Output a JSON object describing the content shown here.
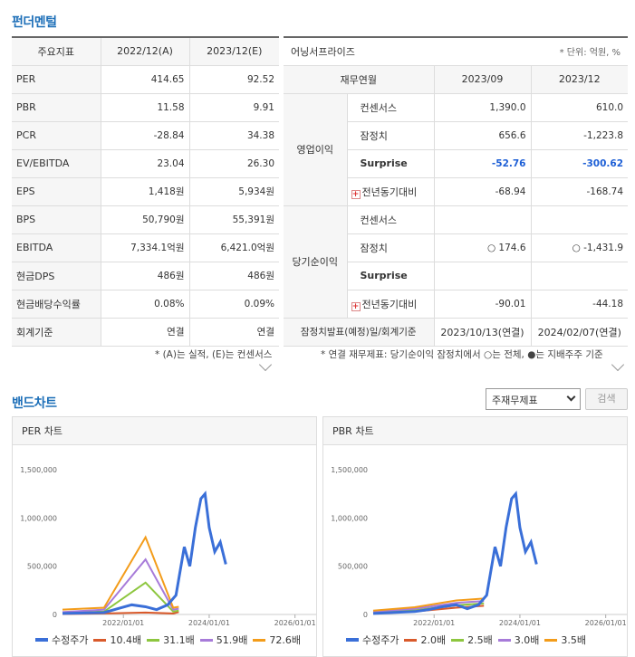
{
  "fundamentals": {
    "title": "펀더멘털",
    "table": {
      "headers": [
        "주요지표",
        "2022/12(A)",
        "2023/12(E)"
      ],
      "rows": [
        {
          "label": "PER",
          "a": "414.65",
          "e": "92.52"
        },
        {
          "label": "PBR",
          "a": "11.58",
          "e": "9.91"
        },
        {
          "label": "PCR",
          "a": "-28.84",
          "e": "34.38"
        },
        {
          "label": "EV/EBITDA",
          "a": "23.04",
          "e": "26.30"
        },
        {
          "label": "EPS",
          "a": "1,418원",
          "e": "5,934원"
        },
        {
          "label": "BPS",
          "a": "50,790원",
          "e": "55,391원"
        },
        {
          "label": "EBITDA",
          "a": "7,334.1억원",
          "e": "6,421.0억원"
        },
        {
          "label": "현금DPS",
          "a": "486원",
          "e": "486원"
        },
        {
          "label": "현금배당수익률",
          "a": "0.08%",
          "e": "0.09%"
        },
        {
          "label": "회계기준",
          "a": "연결",
          "e": "연결"
        }
      ],
      "note": "* (A)는 실적, (E)는 컨센서스"
    },
    "earnings": {
      "title": "어닝서프라이즈",
      "unit": "* 단위: 억원, %",
      "headers": [
        "재무연월",
        "2023/09",
        "2023/12"
      ],
      "op_group": "영업이익",
      "net_group": "당기순이익",
      "op_rows": [
        {
          "label": "컨센서스",
          "a": "1,390.0",
          "b": "610.0"
        },
        {
          "label": "잠정치",
          "a": "656.6",
          "b": "-1,223.8"
        },
        {
          "label": "Surprise",
          "a": "-52.76",
          "b": "-300.62"
        },
        {
          "label": "전년동기대비",
          "a": "-68.94",
          "b": "-168.74"
        }
      ],
      "net_rows": [
        {
          "label": "컨센서스",
          "a": "",
          "b": ""
        },
        {
          "label": "잠정치",
          "a": "○ 174.6",
          "b": "○ -1,431.9"
        },
        {
          "label": "Surprise",
          "a": "",
          "b": ""
        },
        {
          "label": "전년동기대비",
          "a": "-90.01",
          "b": "-44.18"
        }
      ],
      "footer": {
        "label": "잠정치발표(예정)일/회계기준",
        "a": "2023/10/13(연결)",
        "b": "2024/02/07(연결)"
      },
      "note": "* 연결 재무제표: 당기순이익 잠정치에서 ○는 전체, ●는 지배주주 기준"
    }
  },
  "band": {
    "title": "밴드차트",
    "select_value": "주재무제표",
    "search_label": "검색",
    "per_panel_title": "PER 차트",
    "pbr_panel_title": "PBR 차트"
  },
  "chart_data": [
    {
      "type": "line",
      "title": "PER 차트",
      "x_ticks": [
        "2022/01/01",
        "2024/01/01",
        "2026/01/01"
      ],
      "y_ticks": [
        "1,500,000",
        "1,000,000",
        "500,000",
        "0"
      ],
      "ylim": [
        0,
        1500000
      ],
      "series": [
        {
          "name": "수정주가",
          "color": "#3a6fd8",
          "points": [
            [
              0,
              10000
            ],
            [
              1.5,
              20000
            ],
            [
              2,
              60000
            ],
            [
              2.5,
              100000
            ],
            [
              3,
              80000
            ],
            [
              3.4,
              50000
            ],
            [
              3.8,
              100000
            ],
            [
              4.1,
              200000
            ],
            [
              4.4,
              700000
            ],
            [
              4.6,
              500000
            ],
            [
              4.8,
              900000
            ],
            [
              5.0,
              1200000
            ],
            [
              5.15,
              1250000
            ],
            [
              5.3,
              900000
            ],
            [
              5.5,
              650000
            ],
            [
              5.7,
              750000
            ],
            [
              5.9,
              520000
            ]
          ]
        },
        {
          "name": "10.4배",
          "color": "#d95a2b",
          "points": [
            [
              0,
              5000
            ],
            [
              1.5,
              10000
            ],
            [
              3,
              20000
            ],
            [
              4,
              10000
            ],
            [
              4.2,
              25000
            ]
          ]
        },
        {
          "name": "31.1배",
          "color": "#8dc63f",
          "points": [
            [
              0,
              15000
            ],
            [
              1.5,
              30000
            ],
            [
              3,
              330000
            ],
            [
              4,
              30000
            ],
            [
              4.2,
              40000
            ]
          ]
        },
        {
          "name": "51.9배",
          "color": "#a77bd9",
          "points": [
            [
              0,
              25000
            ],
            [
              1.5,
              50000
            ],
            [
              3,
              570000
            ],
            [
              4,
              50000
            ],
            [
              4.2,
              60000
            ]
          ]
        },
        {
          "name": "72.6배",
          "color": "#f39c1a",
          "points": [
            [
              0,
              50000
            ],
            [
              1.5,
              70000
            ],
            [
              3,
              800000
            ],
            [
              4,
              70000
            ],
            [
              4.2,
              80000
            ]
          ]
        }
      ]
    },
    {
      "type": "line",
      "title": "PBR 차트",
      "x_ticks": [
        "2022/01/01",
        "2024/01/01",
        "2026/01/01"
      ],
      "y_ticks": [
        "1,500,000",
        "1,000,000",
        "500,000",
        "0"
      ],
      "ylim": [
        0,
        1500000
      ],
      "series": [
        {
          "name": "수정주가",
          "color": "#3a6fd8",
          "points": [
            [
              0,
              10000
            ],
            [
              1.5,
              30000
            ],
            [
              2,
              50000
            ],
            [
              2.5,
              80000
            ],
            [
              3,
              100000
            ],
            [
              3.4,
              60000
            ],
            [
              3.8,
              100000
            ],
            [
              4.1,
              200000
            ],
            [
              4.4,
              700000
            ],
            [
              4.6,
              500000
            ],
            [
              4.8,
              900000
            ],
            [
              5.0,
              1200000
            ],
            [
              5.15,
              1250000
            ],
            [
              5.3,
              900000
            ],
            [
              5.5,
              650000
            ],
            [
              5.7,
              750000
            ],
            [
              5.9,
              520000
            ]
          ]
        },
        {
          "name": "2.0배",
          "color": "#d95a2b",
          "points": [
            [
              0,
              10000
            ],
            [
              1.5,
              30000
            ],
            [
              3,
              70000
            ],
            [
              4,
              90000
            ]
          ]
        },
        {
          "name": "2.5배",
          "color": "#8dc63f",
          "points": [
            [
              0,
              20000
            ],
            [
              1.5,
              45000
            ],
            [
              3,
              95000
            ],
            [
              4,
              115000
            ]
          ]
        },
        {
          "name": "3.0배",
          "color": "#a77bd9",
          "points": [
            [
              0,
              30000
            ],
            [
              1.5,
              60000
            ],
            [
              3,
              120000
            ],
            [
              4,
              140000
            ]
          ]
        },
        {
          "name": "3.5배",
          "color": "#f39c1a",
          "points": [
            [
              0,
              40000
            ],
            [
              1.5,
              75000
            ],
            [
              3,
              145000
            ],
            [
              4,
              165000
            ]
          ]
        }
      ]
    }
  ]
}
